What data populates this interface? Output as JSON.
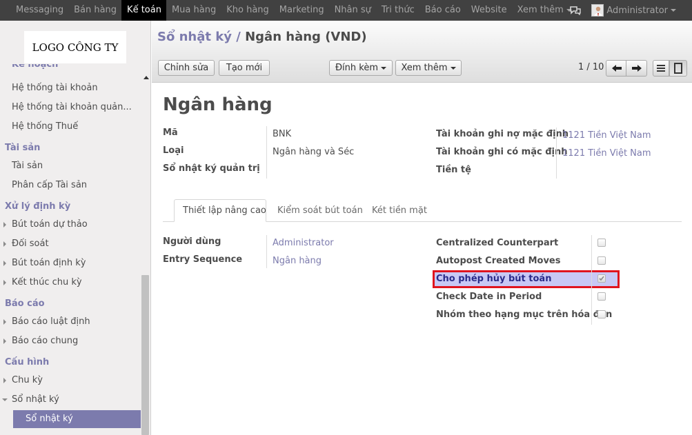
{
  "topbar": {
    "menu": [
      "Messaging",
      "Bán hàng",
      "Kế toán",
      "Mua hàng",
      "Kho hàng",
      "Marketing",
      "Nhân sự",
      "Tri thức",
      "Báo cáo",
      "Website",
      "Xem thêm"
    ],
    "active_index": 2,
    "user": "Administrator"
  },
  "sidebar": {
    "logo": "LOGO CÔNG TY",
    "clipped_heading": "Kế hoạch",
    "items": {
      "he_thong_tai_khoan": "Hệ thống tài khoản",
      "he_thong_tai_khoan_quan": "Hệ thống tài khoản quản...",
      "he_thong_thue": "Hệ thống Thuế",
      "tai_san_head": "Tài sản",
      "tai_san": "Tài sản",
      "phan_cap_tai_san": "Phân cấp Tài sản",
      "xu_ly_dinh_ky_head": "Xử lý định kỳ",
      "but_toan_du_thao": "Bút toán dự thảo",
      "doi_soat": "Đối soát",
      "but_toan_dinh_ky": "Bút toán định kỳ",
      "ket_thuc_chu_ky": "Kết thúc chu kỳ",
      "bao_cao_head": "Báo cáo",
      "bao_cao_luat_dinh": "Báo cáo luật định",
      "bao_cao_chung": "Báo cáo chung",
      "cau_hinh_head": "Cấu hình",
      "chu_ky": "Chu kỳ",
      "so_nhat_ky_parent": "Sổ nhật ký",
      "so_nhat_ky_active": "Sổ nhật ký"
    }
  },
  "breadcrumb": {
    "parent": "Sổ nhật ký",
    "separator": "/",
    "current": "Ngân hàng (VND)"
  },
  "toolbar": {
    "edit": "Chỉnh sửa",
    "create": "Tạo mới",
    "attach": "Đính kèm",
    "more": "Xem thêm",
    "pager": "1 / 10"
  },
  "form": {
    "title": "Ngân hàng",
    "fields_left": {
      "code_label": "Mã",
      "code_value": "BNK",
      "type_label": "Loại",
      "type_value": "Ngân hàng và Séc",
      "analytic_label": "Sổ nhật ký quản trị"
    },
    "fields_right": {
      "debit_label": "Tài khoản ghi nợ mặc định",
      "debit_value": "1121 Tiền Việt Nam",
      "credit_label": "Tài khoản ghi có mặc định",
      "credit_value": "1121 Tiền Việt Nam",
      "currency_label": "Tiền tệ"
    },
    "tabs": [
      "Thiết lập nâng cao",
      "Kiểm soát bút toán",
      "Két tiền mặt"
    ],
    "tab_content": {
      "users_label": "Người dùng",
      "users_value": "Administrator",
      "sequence_label": "Entry Sequence",
      "sequence_value": "Ngân hàng"
    },
    "checkboxes": [
      {
        "label": "Centralized Counterpart",
        "checked": false
      },
      {
        "label": "Autopost Created Moves",
        "checked": false
      },
      {
        "label": "Cho phép hủy bút toán",
        "checked": true
      },
      {
        "label": "Check Date in Period",
        "checked": false
      },
      {
        "label": "Nhóm theo hạng mục trên hóa đơn",
        "checked": false
      }
    ]
  },
  "colors": {
    "accent": "#7c7bad",
    "topbar": "#414141",
    "highlight": "#c8c8f5",
    "highlight_border": "#e0141e"
  }
}
